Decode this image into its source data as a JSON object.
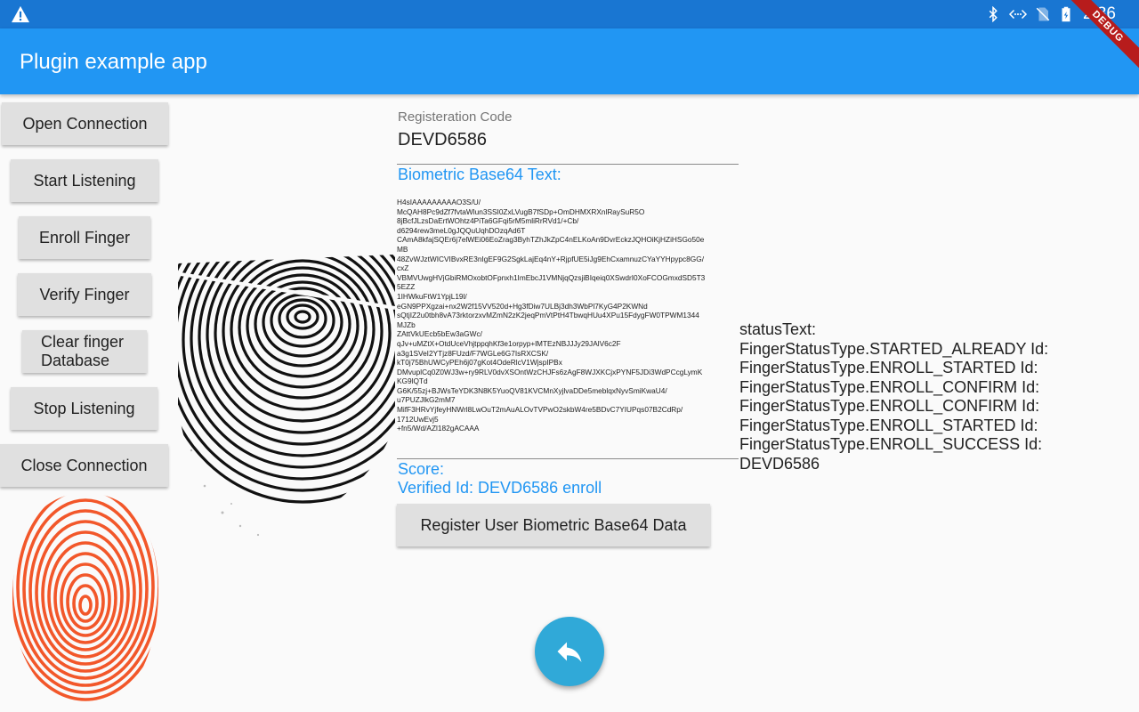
{
  "status_bar": {
    "time": "2:36"
  },
  "app_bar": {
    "title": "Plugin example app",
    "debug_banner": "DEBUG"
  },
  "buttons": {
    "open_connection": "Open Connection",
    "start_listening": "Start Listening",
    "enroll_finger": "Enroll Finger",
    "verify_finger": "Verify Finger",
    "clear_database_line1": "Clear finger",
    "clear_database_line2": "Database",
    "stop_listening": "Stop Listening",
    "close_connection": "Close Connection",
    "register_user": "Register User Biometric Base64 Data"
  },
  "registration": {
    "label": "Registeration Code",
    "value": "DEVD6586"
  },
  "biometric": {
    "label": "Biometric Base64 Text:",
    "text": "H4sIAAAAAAAAAO3S/U/\nMcQAH8Pc9dZf7fvtaWlun3SSI0ZxLVugB7fSDp+OmDHMXRXnlRaySuR5O\n8jBcfJLzsDaErtWOhtz4PiTa6GFqi5rM5mliRrRVd1/+Cb/\nd6294rew3meL0gJQQuUqhDOzqAd6T\nCAmA8kfajSQEr6j7elWEi06EoZrag3ByhTZhJkZpC4nELKoAn9DvrEckzJQHOiKjHZiHSGo50e\nMB\n48ZvWJztWICVIBvxRE3nIgEF9G2SgkLajEq4nY+RjpfUE5iJg9EhCxamnuzCYaYYHpypc8GG/\ncxZ\nVBMVUwgHVjGbiRMOxobtOFpnxh1ImEbcJ1VMNjqQzsjiBIqeiq0XSwdrI0XoFCOGmxdSD5T3\n5EZZ\n1IHWkuFtW1YpjL19l/\neGN9PPXgzai+nx2W2f15VV520d+Hg3fDiw7ULBj3dh3WbPl7KyG4P2KWNd\nsQtjIZ2u0tbh8vA73rktorzxvMZmN2zK2jeqPmVtPtH4TbwqHUu4XPu15FdygFW0TPWM1344\nMJZb\nZAttVkUEcb5bEw3aGWc/\nqJv+uMZtX+OtdUceVhjtppqhKf3e1orpyp+lMTEzNBJJJy29JAlV6c2F\na3g1SVeI2YTjz8FUzd/F7WGLe6G7IsRXCSK/\nkT0j75BhUWCyPEh6j07gKot4OdeRlcV1WjspIPBx\nDMvuplCq0Z0WJ3w+ry9RLV0dvXSOntWzCHJFs6zAgF8WJXKCjxPYNF5JDi3WdPCcgLymK\nKG9lQTd\nG6K/55zj+BJWsTeYDK3N8K5YuoQV81KVCMnXyjlvaDDe5meblqxNyvSmiKwaU4/\nu7PUZJlkG2mM7\nMifF3HRvYjfeyHNWrl8LwOuT2mAuALOvTVPwO2skbW4re5BDvC7YIUPqs07B2CdRp/\n1712UwEvj5\n+fn5/Wd/AZl182gACAAA"
  },
  "result": {
    "score_label": "Score:",
    "verified_label": "Verified Id: DEVD6586 enroll"
  },
  "status": {
    "text": "statusText:\nFingerStatusType.STARTED_ALREADY Id:\nFingerStatusType.ENROLL_STARTED Id:\nFingerStatusType.ENROLL_CONFIRM Id:\nFingerStatusType.ENROLL_CONFIRM Id:\nFingerStatusType.ENROLL_STARTED Id:\nFingerStatusType.ENROLL_SUCCESS Id:\nDEVD6586"
  },
  "icons": {
    "warning": "warning-icon",
    "bluetooth": "bluetooth-icon",
    "code": "code-icon",
    "no_sim": "no-sim-icon",
    "battery": "battery-icon",
    "back": "reply-icon",
    "fingerprint_gray": "fingerprint-image",
    "fingerprint_orange": "fingerprint-logo"
  },
  "colors": {
    "status_bar": "#1976d2",
    "app_bar": "#2196f3",
    "accent_text": "#2196f3",
    "button": "#e0e0e0",
    "fab": "#30a9d8",
    "fingerprint_logo": "#f2572a",
    "debug_banner": "#b71c1c"
  }
}
